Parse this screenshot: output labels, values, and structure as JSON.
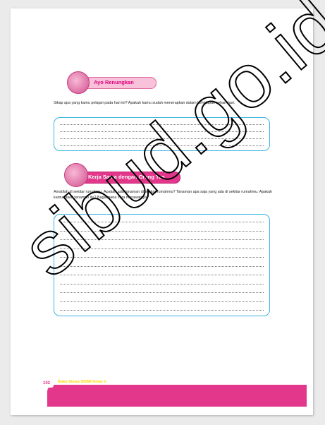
{
  "section1": {
    "title": "Ayo Renungkan",
    "prompt": "Sikap apa yang kamu pelajari pada hari ini? Apakah kamu sudah menerapkan dalam kehidupan sehari-hari.",
    "line_count": 4
  },
  "section2": {
    "title": "Kerja Sama dengan Orang Tua",
    "prompt": "Amatilah di sekitar rumahmu. Apakah ada tanaman di sekitar rumahmu? Tanaman apa saja yang ada di sekitar rumahmu. Apakah kamu rawat tanaman itu? Bagaimana cara merawatnya?",
    "line_count": 11
  },
  "footer": {
    "page_number": "102",
    "book_title": "Buku Siswa SD/MI Kelas V"
  },
  "watermark": "sibud.go.id",
  "colors": {
    "accent": "#e2378b",
    "box_border": "#3ab3e0",
    "footer_text": "#ffd800"
  }
}
